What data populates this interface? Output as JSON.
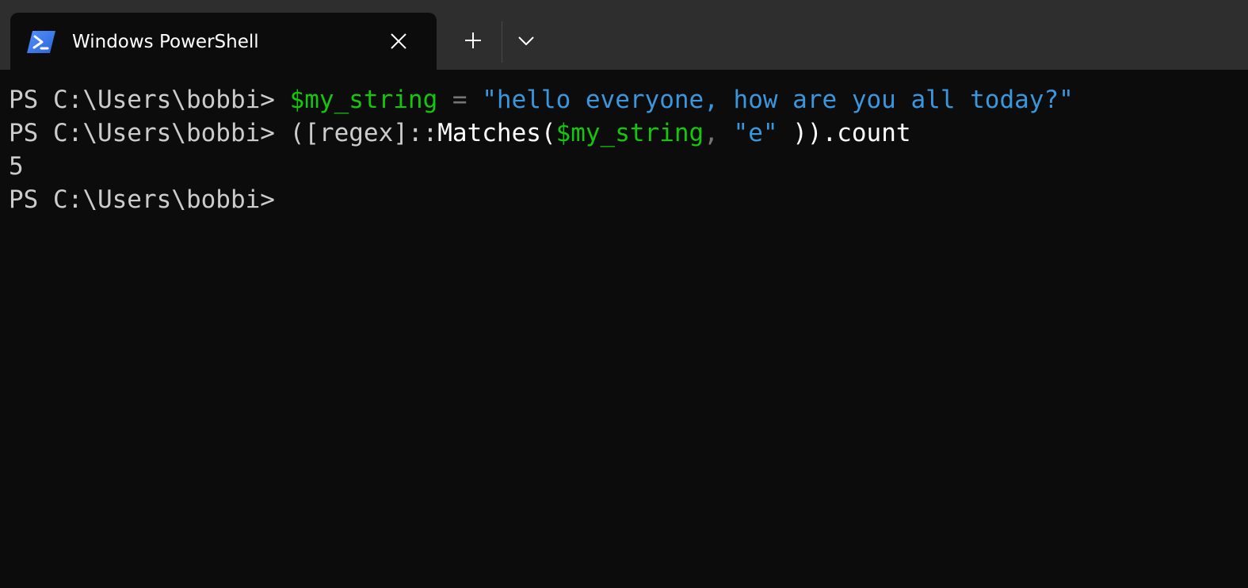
{
  "window": {
    "tab": {
      "title": "Windows PowerShell",
      "icon": "powershell-icon"
    },
    "controls": {
      "close_icon": "close-icon",
      "new_tab_icon": "plus-icon",
      "dropdown_icon": "chevron-down-icon"
    }
  },
  "terminal": {
    "prompt": "PS C:\\Users\\bobbi> ",
    "line1": {
      "var": "$my_string",
      "op": " = ",
      "str": "\"hello everyone, how are you all today?\""
    },
    "line2": {
      "open": "([regex]::",
      "method": "Matches(",
      "var": "$my_string",
      "comma": ",",
      "space": " ",
      "str": "\"e\"",
      "close": " )).count"
    },
    "output": "5",
    "prompt_last": "PS C:\\Users\\bobbi>"
  },
  "colors": {
    "background": "#0c0c0c",
    "titlebar": "#2e2e2e",
    "variable": "#16c60c",
    "string": "#3a96dd",
    "operator": "#767676",
    "text": "#cccccc"
  }
}
